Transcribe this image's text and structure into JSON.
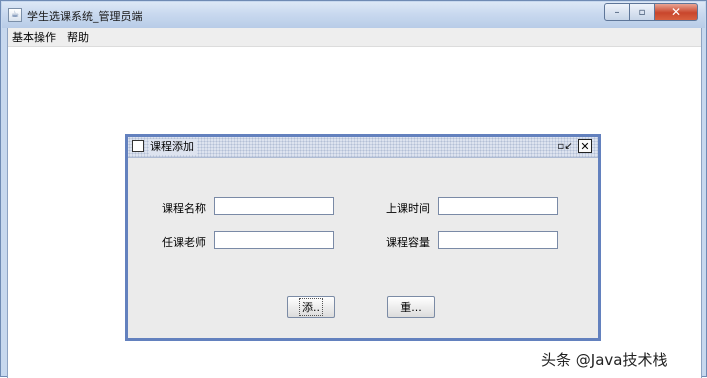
{
  "window": {
    "title": "学生选课系统_管理员端",
    "app_icon": "java-cup-icon",
    "controls": {
      "minimize": "–",
      "maximize": "▫",
      "close": "✕"
    }
  },
  "menubar": {
    "items": [
      {
        "label": "基本操作"
      },
      {
        "label": "帮助"
      }
    ]
  },
  "internal_frame": {
    "title": "课程添加",
    "restore_glyph": "▫↙",
    "close_glyph": "✕",
    "fields": {
      "course_name": {
        "label": "课程名称",
        "value": ""
      },
      "class_time": {
        "label": "上课时间",
        "value": ""
      },
      "teacher": {
        "label": "任课老师",
        "value": ""
      },
      "capacity": {
        "label": "课程容量",
        "value": ""
      }
    },
    "buttons": {
      "add": "添..",
      "reset": "重..."
    }
  },
  "watermark": "头条 @Java技术栈",
  "colors": {
    "frame_border": "#6381be",
    "panel_bg": "#ebebeb",
    "title_bg": "#dde3ef",
    "window_chrome": "#c7d8ee"
  }
}
